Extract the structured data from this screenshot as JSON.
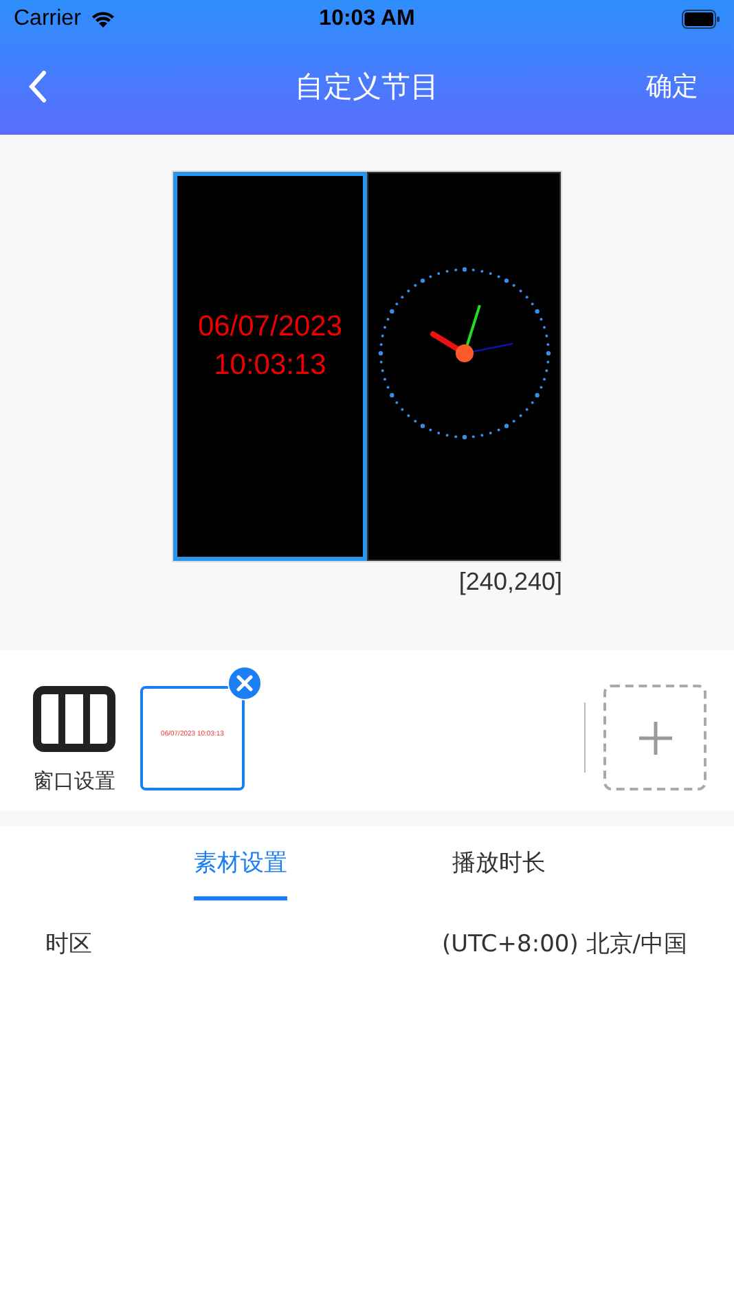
{
  "status_bar": {
    "carrier": "Carrier",
    "time": "10:03 AM"
  },
  "nav": {
    "title": "自定义节目",
    "confirm": "确定"
  },
  "preview": {
    "windows": [
      {
        "kind": "digital",
        "selected": true,
        "lines": [
          "06/07/2023",
          "10:03:13"
        ]
      },
      {
        "kind": "analog",
        "selected": false
      }
    ],
    "resolution": "[240,240]"
  },
  "materials": {
    "window_settings_label": "窗口设置",
    "items": [
      {
        "text": "06/07/2023 10:03:13",
        "selected": true
      }
    ]
  },
  "tabs": [
    {
      "label": "素材设置",
      "selected": true
    },
    {
      "label": "播放时长",
      "selected": false
    }
  ],
  "settings": [
    {
      "label": "时区",
      "value": "(UTC+8:00)  北京/中国"
    }
  ]
}
